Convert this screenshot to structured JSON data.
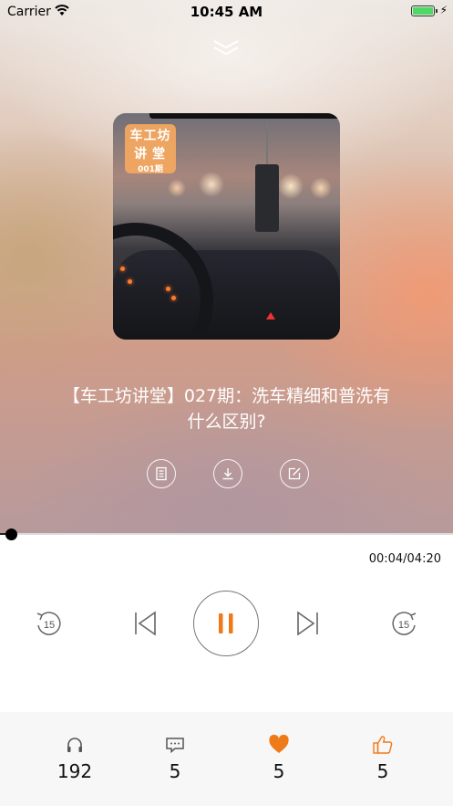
{
  "status_bar": {
    "carrier": "Carrier",
    "time": "10:45 AM"
  },
  "cover": {
    "badge_line1": "车工坊",
    "badge_line2": "讲堂",
    "badge_line3": "001期"
  },
  "episode": {
    "title_line1": "【车工坊讲堂】027期：洗车精细和普洗有",
    "title_line2": "什么区别?"
  },
  "actions": [
    {
      "icon": "document-list-icon"
    },
    {
      "icon": "download-icon"
    },
    {
      "icon": "share-edit-icon"
    }
  ],
  "player": {
    "time_display": "00:04/04:20",
    "progress": 0.015,
    "rewind_label": "15",
    "forward_label": "15",
    "accent": "#ef7a1a"
  },
  "stats": [
    {
      "icon": "headphones-icon",
      "count": "192"
    },
    {
      "icon": "comment-icon",
      "count": "5"
    },
    {
      "icon": "heart-icon",
      "count": "5"
    },
    {
      "icon": "thumbs-up-icon",
      "count": "5"
    }
  ]
}
